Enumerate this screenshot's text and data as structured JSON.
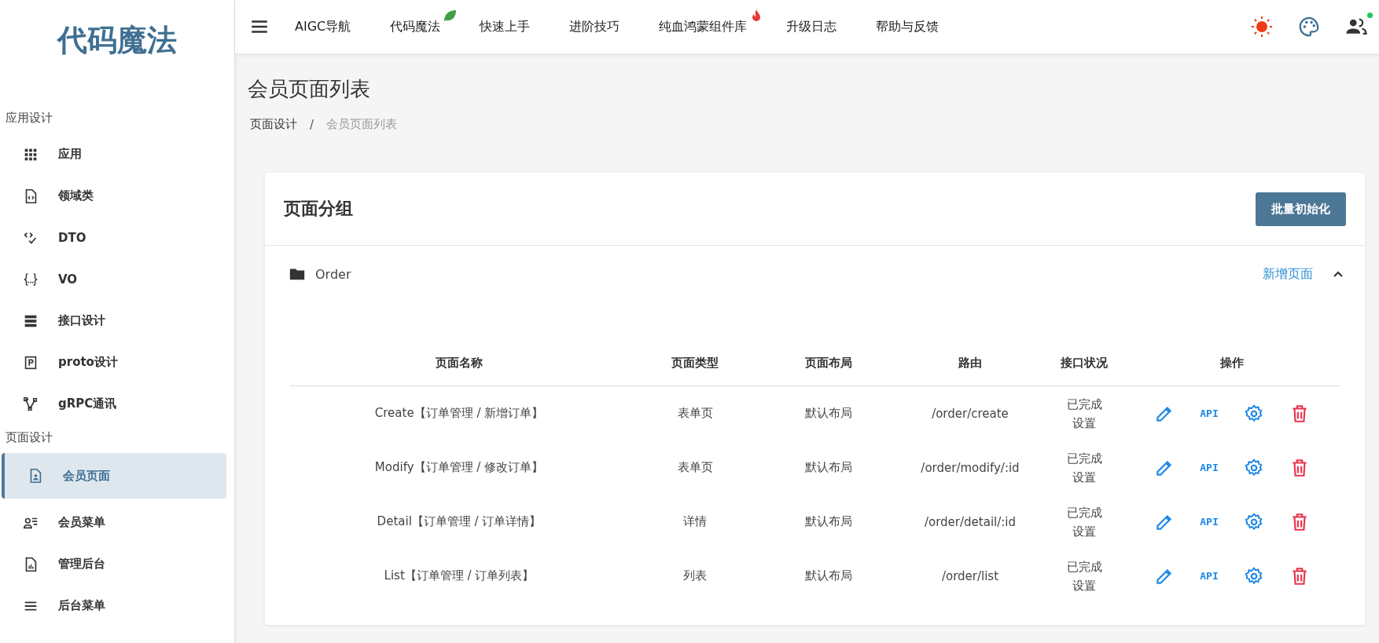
{
  "sidebar": {
    "logo": "代码魔法",
    "sections": [
      {
        "title": "应用设计",
        "items": [
          {
            "label": "应用",
            "selected": false
          },
          {
            "label": "领域类",
            "selected": false
          },
          {
            "label": "DTO",
            "selected": false
          },
          {
            "label": "VO",
            "selected": false
          },
          {
            "label": "接口设计",
            "selected": false
          },
          {
            "label": "proto设计",
            "selected": false
          },
          {
            "label": "gRPC通讯",
            "selected": false
          }
        ]
      },
      {
        "title": "页面设计",
        "items": [
          {
            "label": "会员页面",
            "selected": true
          },
          {
            "label": "会员菜单",
            "selected": false
          },
          {
            "label": "管理后台",
            "selected": false
          },
          {
            "label": "后台菜单",
            "selected": false
          }
        ]
      }
    ]
  },
  "top_nav": {
    "items": [
      {
        "label": "AIGC导航",
        "kind": "plain"
      },
      {
        "label": "代码魔法",
        "kind": "leaf"
      },
      {
        "label": "快速上手",
        "kind": "plain"
      },
      {
        "label": "进阶技巧",
        "kind": "plain"
      },
      {
        "label": "纯血鸿蒙组件库",
        "kind": "fire"
      },
      {
        "label": "升级日志",
        "kind": "plain"
      },
      {
        "label": "帮助与反馈",
        "kind": "plain"
      }
    ],
    "online": true
  },
  "page_title": "会员页面列表",
  "breadcrumb": {
    "items": [
      "页面设计",
      "会员页面列表"
    ],
    "separator": "/"
  },
  "card": {
    "title": "页面分组",
    "action": "批量初始化",
    "group": {
      "name": "Order",
      "add_label": "新增页面",
      "expanded": true
    },
    "table": {
      "columns": [
        "页面名称",
        "页面类型",
        "页面布局",
        "路由",
        "接口状况",
        "操作"
      ],
      "rows": [
        {
          "name": "Create【订单管理 / 新增订单】",
          "type": "表单页",
          "layout": "默认布局",
          "route": "/order/create",
          "status": "已完成",
          "status_action": "设置",
          "api": "API"
        },
        {
          "name": "Modify【订单管理 / 修改订单】",
          "type": "表单页",
          "layout": "默认布局",
          "route": "/order/modify/:id",
          "status": "已完成",
          "status_action": "设置",
          "api": "API"
        },
        {
          "name": "Detail【订单管理 / 订单详情】",
          "type": "详情",
          "layout": "默认布局",
          "route": "/order/detail/:id",
          "status": "已完成",
          "status_action": "设置",
          "api": "API"
        },
        {
          "name": "List【订单管理 / 订单列表】",
          "type": "列表",
          "layout": "默认布局",
          "route": "/order/list",
          "status": "已完成",
          "status_action": "设置",
          "api": "API"
        }
      ]
    }
  }
}
